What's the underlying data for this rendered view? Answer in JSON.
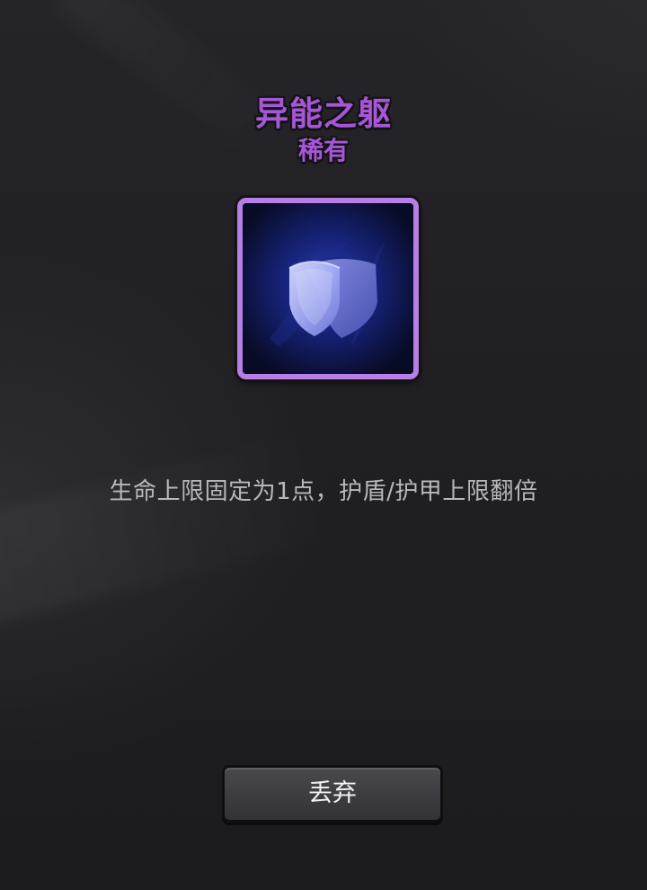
{
  "item": {
    "name": "异能之躯",
    "rarity": "稀有",
    "rarity_color": "#a657d8",
    "frame_color": "#b77ee6",
    "icon": "shield-icon",
    "description": "生命上限固定为1点，护盾/护甲上限翻倍"
  },
  "actions": {
    "discard_label": "丢弃"
  }
}
